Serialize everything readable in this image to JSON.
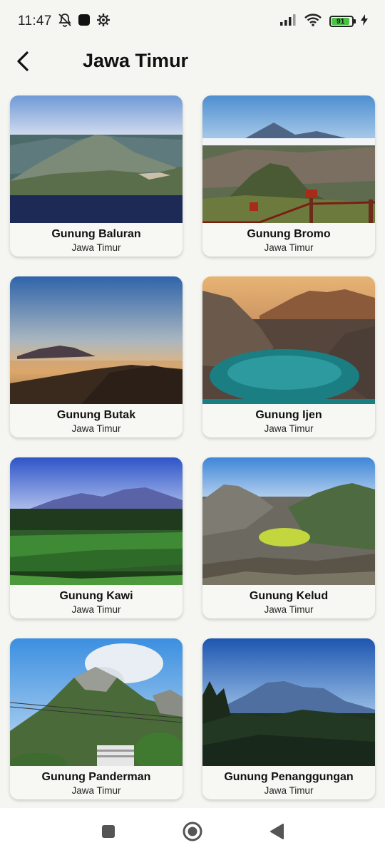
{
  "status_bar": {
    "time": "11:47",
    "battery_level": "91",
    "icons": [
      "notifications-off-icon",
      "app-icon",
      "settings-icon",
      "signal-icon",
      "wifi-icon",
      "battery-icon",
      "charging-icon"
    ]
  },
  "header": {
    "title": "Jawa Timur",
    "back_icon": "back-arrow-icon"
  },
  "mountains": [
    {
      "name": "Gunung Baluran",
      "region": "Jawa Timur"
    },
    {
      "name": "Gunung Bromo",
      "region": "Jawa Timur"
    },
    {
      "name": "Gunung Butak",
      "region": "Jawa Timur"
    },
    {
      "name": "Gunung Ijen",
      "region": "Jawa Timur"
    },
    {
      "name": "Gunung Kawi",
      "region": "Jawa Timur"
    },
    {
      "name": "Gunung Kelud",
      "region": "Jawa Timur"
    },
    {
      "name": "Gunung Panderman",
      "region": "Jawa Timur"
    },
    {
      "name": "Gunung Penanggungan",
      "region": "Jawa Timur"
    }
  ],
  "nav_bar": {
    "icons": [
      "recents-square-icon",
      "home-circle-icon",
      "back-triangle-icon"
    ]
  }
}
